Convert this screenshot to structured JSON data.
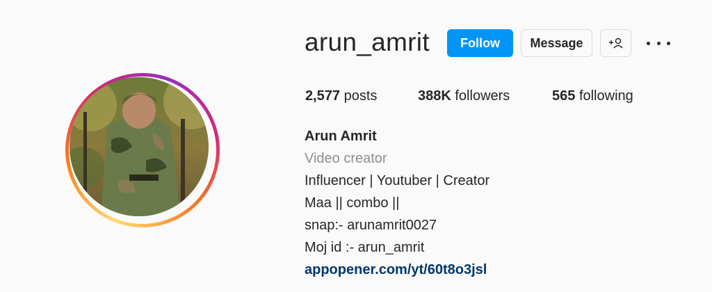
{
  "profile": {
    "username": "arun_amrit",
    "follow_label": "Follow",
    "message_label": "Message",
    "stats": {
      "posts_count": "2,577",
      "posts_label": "posts",
      "followers_count": "388K",
      "followers_label": "followers",
      "following_count": "565",
      "following_label": "following"
    },
    "full_name": "Arun Amrit",
    "category": "Video creator",
    "bio_lines": [
      "Influencer | Youtuber | Creator",
      "Maa || combo ||",
      "snap:- arunamrit0027",
      "Moj id :- arun_amrit"
    ],
    "link": "appopener.com/yt/60t8o3jsl"
  },
  "icons": {
    "suggest": "add-person-icon",
    "more": "more-horizontal-icon"
  },
  "colors": {
    "follow_button": "#0095f6",
    "link": "#00376b",
    "category": "#8e8e8e"
  }
}
